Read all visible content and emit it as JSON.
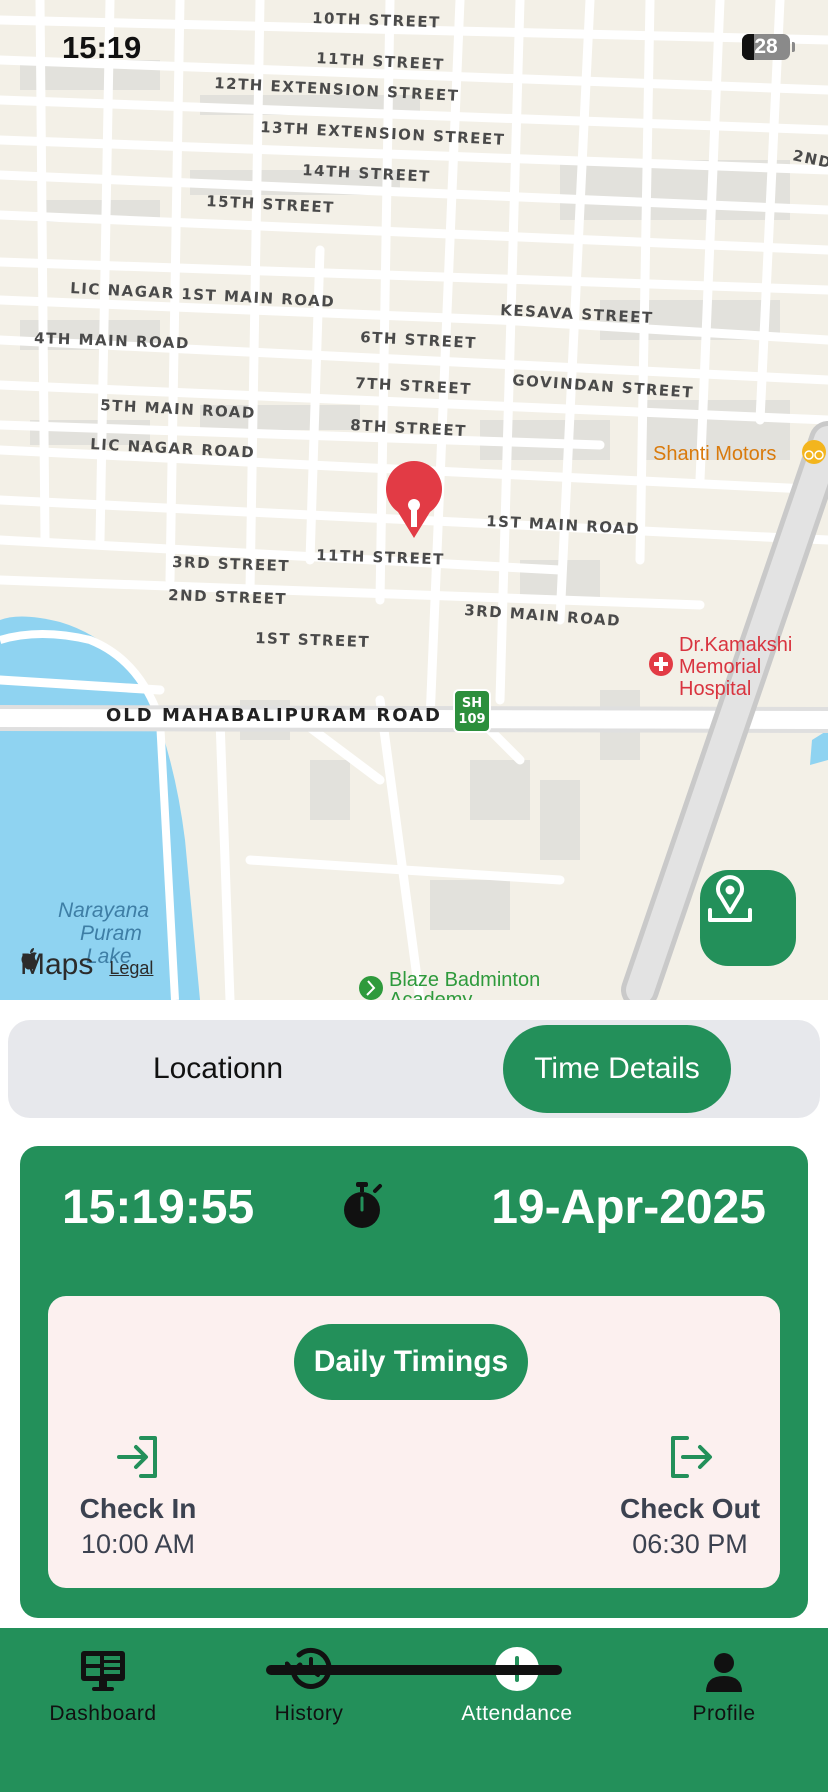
{
  "status_bar": {
    "time": "15:19",
    "battery": "28"
  },
  "map": {
    "streets": [
      "10TH STREET",
      "11TH STREET",
      "12TH EXTENSION STREET",
      "13TH EXTENSION STREET",
      "14TH STREET",
      "15TH STREET",
      "LIC NAGAR 1ST MAIN ROAD",
      "4TH MAIN ROAD",
      "KESAVA STREET",
      "6TH STREET",
      "7TH STREET",
      "GOVINDAN STREET",
      "5TH MAIN ROAD",
      "8TH STREET",
      "LIC NAGAR ROAD",
      "1ST MAIN ROAD",
      "3RD STREET",
      "11TH STREET",
      "2ND STREET",
      "3RD MAIN ROAD",
      "1ST STREET",
      "OLD MAHABALIPURAM ROAD",
      "2ND"
    ],
    "highway_shield": {
      "line1": "SH",
      "line2": "109"
    },
    "pois": {
      "shanti": "Shanti Motors",
      "hospital_line1": "Dr.Kamakshi",
      "hospital_line2": "Memorial",
      "hospital_line3": "Hospital",
      "badminton_line1": "Blaze Badminton",
      "badminton_line2": "Academy"
    },
    "lake": {
      "line1": "Narayana",
      "line2": "Puram",
      "line3": "Lake"
    },
    "brand": "Maps",
    "legal": "Legal",
    "colors": {
      "land": "#f3f0e7",
      "water": "#8fd3f1",
      "road": "#ffffff",
      "pin": "#e23b45"
    }
  },
  "tabs": {
    "location": "Locationn",
    "time_details": "Time Details",
    "active": "time_details"
  },
  "time_card": {
    "clock": "15:19:55",
    "date": "19-Apr-2025",
    "daily_title": "Daily Timings",
    "check_in": {
      "label": "Check In",
      "time": "10:00 AM"
    },
    "check_out": {
      "label": "Check Out",
      "time": "06:30 PM"
    }
  },
  "nav": {
    "dashboard": "Dashboard",
    "history": "History",
    "attendance": "Attendance",
    "profile": "Profile",
    "active": "attendance"
  },
  "colors": {
    "primary": "#23905a",
    "daily_bg": "#fcf0ef",
    "segment_bg": "#e7e8ec"
  },
  "icons": {
    "stopwatch": "stopwatch-icon",
    "check_in": "login-icon",
    "check_out": "logout-icon",
    "locate": "location-pin-icon",
    "dashboard": "monitor-icon",
    "history": "history-icon",
    "attendance": "plus-circle-icon",
    "profile": "person-icon"
  }
}
